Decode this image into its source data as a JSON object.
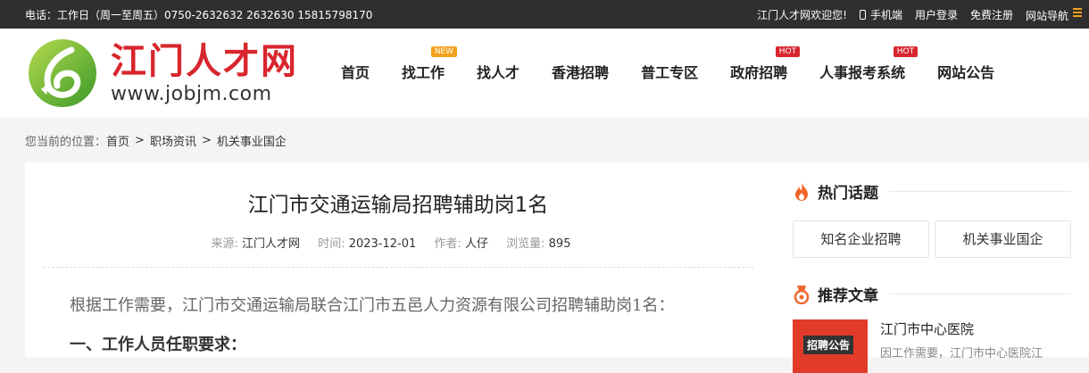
{
  "topbar": {
    "contact": "电话：工作日（周一至周五）0750-2632632 2632630 15815798170",
    "welcome": "江门人才网欢迎您!",
    "mobile": "手机端",
    "login": "用户登录",
    "register": "免费注册",
    "sitenav": "网站导航"
  },
  "logo": {
    "name": "江门人才网",
    "url": "www.jobjm.com"
  },
  "nav": [
    {
      "label": "首页",
      "badge": ""
    },
    {
      "label": "找工作",
      "badge": "NEW"
    },
    {
      "label": "找人才",
      "badge": ""
    },
    {
      "label": "香港招聘",
      "badge": ""
    },
    {
      "label": "普工专区",
      "badge": ""
    },
    {
      "label": "政府招聘",
      "badge": "HOT"
    },
    {
      "label": "人事报考系统",
      "badge": "HOT"
    },
    {
      "label": "网站公告",
      "badge": ""
    }
  ],
  "breadcrumb": {
    "prefix": "您当前的位置：",
    "items": [
      "首页",
      "职场资讯",
      "机关事业国企"
    ],
    "separator": ">"
  },
  "article": {
    "title": "江门市交通运输局招聘辅助岗1名",
    "source_label": "来源:",
    "source": "江门人才网",
    "time_label": "时间:",
    "time": "2023-12-01",
    "author_label": "作者:",
    "author": "人仔",
    "views_label": "浏览量:",
    "views": "895",
    "paragraph": "根据工作需要，江门市交通运输局联合江门市五邑人力资源有限公司招聘辅助岗1名：",
    "subheading": "一、工作人员任职要求："
  },
  "sidebar": {
    "hot_title": "热门话题",
    "tags": [
      "知名企业招聘",
      "机关事业国企"
    ],
    "rec_title": "推荐文章",
    "rec_item": {
      "thumb_label": "招聘公告",
      "title": "江门市中心医院",
      "desc": "因工作需要，江门市中心医院江"
    }
  },
  "colors": {
    "brand_red": "#d8262d",
    "accent_orange": "#f3a11c",
    "topbar_bg": "#2f2f2f"
  }
}
